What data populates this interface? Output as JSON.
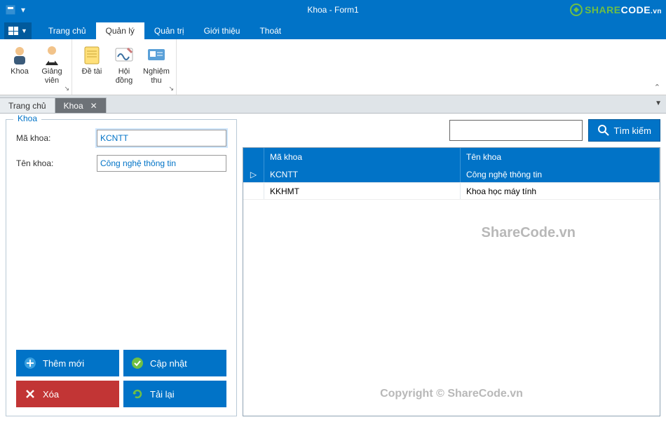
{
  "window": {
    "title": "Khoa - Form1"
  },
  "brand": {
    "text_green": "SHARE",
    "text_white": "CODE",
    "suffix": ".vn"
  },
  "ribbon": {
    "tabs": [
      "Trang chủ",
      "Quản lý",
      "Quản trị",
      "Giới thiệu",
      "Thoát"
    ],
    "active_tab_index": 1,
    "items": [
      {
        "label": "Khoa"
      },
      {
        "label": "Giảng viên"
      },
      {
        "label": "Đề tài"
      },
      {
        "label": "Hội đồng"
      },
      {
        "label": "Nghiệm thu"
      }
    ]
  },
  "doc_tabs": {
    "items": [
      {
        "label": "Trang chủ",
        "closable": false
      },
      {
        "label": "Khoa",
        "closable": true
      }
    ],
    "active_index": 1
  },
  "form": {
    "legend": "Khoa",
    "fields": {
      "ma_khoa": {
        "label": "Mã khoa:",
        "value": "KCNTT"
      },
      "ten_khoa": {
        "label": "Tên khoa:",
        "value": "Công nghệ thông tin"
      }
    },
    "buttons": {
      "add": "Thêm mới",
      "update": "Cập nhật",
      "delete": "Xóa",
      "reload": "Tải lại"
    }
  },
  "search": {
    "value": "",
    "button": "Tìm kiếm"
  },
  "grid": {
    "columns": [
      "Mã khoa",
      "Tên khoa"
    ],
    "rows": [
      {
        "ma": "KCNTT",
        "ten": "Công nghệ thông tin",
        "selected": true
      },
      {
        "ma": "KKHMT",
        "ten": "Khoa học máy tính",
        "selected": false
      }
    ]
  },
  "watermarks": {
    "w1": "ShareCode.vn",
    "w2": "Copyright © ShareCode.vn"
  },
  "colors": {
    "primary": "#0173c7",
    "danger": "#c23535"
  }
}
